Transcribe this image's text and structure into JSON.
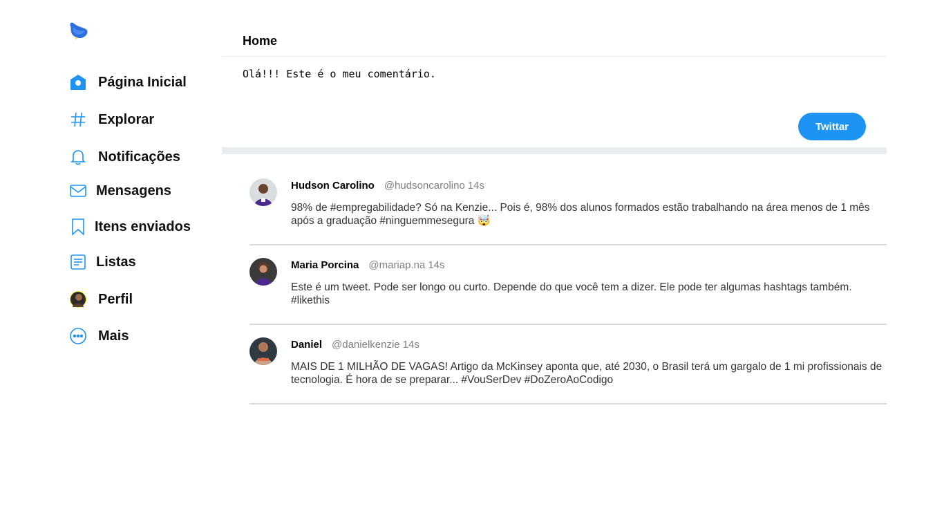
{
  "brand": {
    "logo_icon": "bird-icon",
    "accent": "#1d93f3"
  },
  "sidebar": {
    "items": [
      {
        "label": "Página Inicial",
        "icon": "home-icon"
      },
      {
        "label": "Explorar",
        "icon": "hashtag-icon"
      },
      {
        "label": "Notificações",
        "icon": "bell-icon"
      },
      {
        "label": "Mensagens",
        "icon": "mail-icon"
      },
      {
        "label": "Itens enviados",
        "icon": "bookmark-icon"
      },
      {
        "label": "Listas",
        "icon": "list-icon"
      },
      {
        "label": "Perfil",
        "icon": "profile-avatar"
      },
      {
        "label": "Mais",
        "icon": "more-icon"
      }
    ]
  },
  "main": {
    "title": "Home",
    "compose": {
      "value": "Olá!!! Este é o meu comentário."
    },
    "tweet_button": "Twittar"
  },
  "feed": [
    {
      "author": "Hudson Carolino",
      "handle": "@hudsoncarolino",
      "time": "14s",
      "text": "98% de #empregabilidade? Só na Kenzie... Pois é, 98% dos alunos formados estão trabalhando na área menos de 1 mês após a graduação #ninguemmesegura 🤯"
    },
    {
      "author": "Maria Porcina",
      "handle": "@mariap.na",
      "time": "14s",
      "text": "Este é um tweet. Pode ser longo ou curto. Depende do que você tem a dizer. Ele pode ter algumas hashtags também. #likethis"
    },
    {
      "author": "Daniel",
      "handle": "@danielkenzie",
      "time": "14s",
      "text": "MAIS DE 1 MILHÃO DE VAGAS! Artigo da McKinsey aponta que, até 2030, o Brasil terá um gargalo de 1 mi profissionais de tecnologia. É hora de se preparar... #VouSerDev #DoZeroAoCodigo"
    }
  ]
}
